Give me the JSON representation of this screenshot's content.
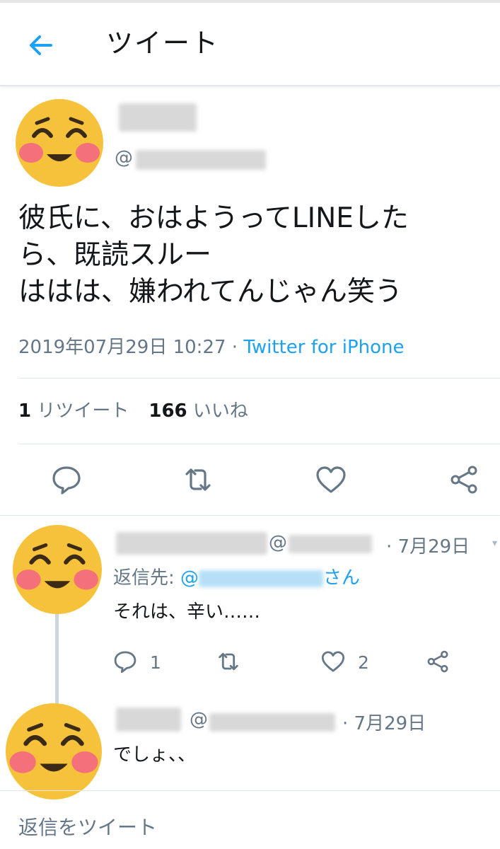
{
  "header": {
    "title": "ツイート"
  },
  "main_tweet": {
    "handle_prefix": "@",
    "text_lines": [
      "彼氏に、おはようってLINEした",
      "ら、既読スルー",
      "ははは、嫌われてんじゃん笑う"
    ],
    "timestamp": "2019年07月29日 10:27",
    "separator": " · ",
    "source": "Twitter for iPhone",
    "retweet_count": "1",
    "retweet_label": " リツイート",
    "like_count": "166",
    "like_label": " いいね"
  },
  "replies": [
    {
      "handle_prefix": "@",
      "date": "· 7月29日",
      "reply_to_label": "返信先: ",
      "reply_to_prefix": "@",
      "reply_to_suffix": "さん",
      "text": "それは、辛い……",
      "reply_count": "1",
      "like_count": "2"
    },
    {
      "handle_prefix": "@",
      "date": "· 7月29日",
      "text": "でしょ、、"
    }
  ],
  "composer": {
    "placeholder": "返信をツイート"
  },
  "colors": {
    "accent": "#1da1f2",
    "secondary_text": "#657786",
    "avatar_face": "#f7c23b",
    "avatar_blush": "#f4707a"
  },
  "icons": [
    "back-arrow-icon",
    "reply-icon",
    "retweet-icon",
    "like-icon",
    "share-icon"
  ]
}
